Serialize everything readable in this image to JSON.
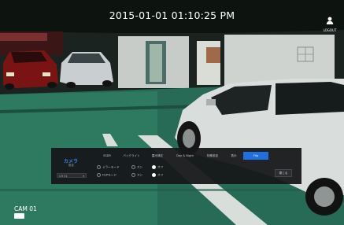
{
  "osd": {
    "timestamp": "2015-01-01 01:10:25 PM",
    "logout_label": "LOGOUT",
    "camera_label": "CAM 01"
  },
  "dialog": {
    "title": "カメラ",
    "subtitle": "設定",
    "camera_select_value": "CH 01",
    "tabs": [
      {
        "label": "SSDR",
        "active": false
      },
      {
        "label": "バックライト",
        "active": false
      },
      {
        "label": "露光補正",
        "active": false
      },
      {
        "label": "Day & Night",
        "active": false
      },
      {
        "label": "特殊設定",
        "active": false
      },
      {
        "label": "表示",
        "active": false
      },
      {
        "label": "Flip",
        "active": true
      }
    ],
    "options": [
      {
        "label": "ミラーモード",
        "on": "オン",
        "off": "オフ",
        "selected": "off"
      },
      {
        "label": "FLIPモード",
        "on": "オン",
        "off": "オフ",
        "selected": "off"
      }
    ],
    "close_label": "閉じる"
  },
  "colors": {
    "accent": "#1f6fe0",
    "title": "#3a7fe6",
    "panel": "#161719"
  }
}
